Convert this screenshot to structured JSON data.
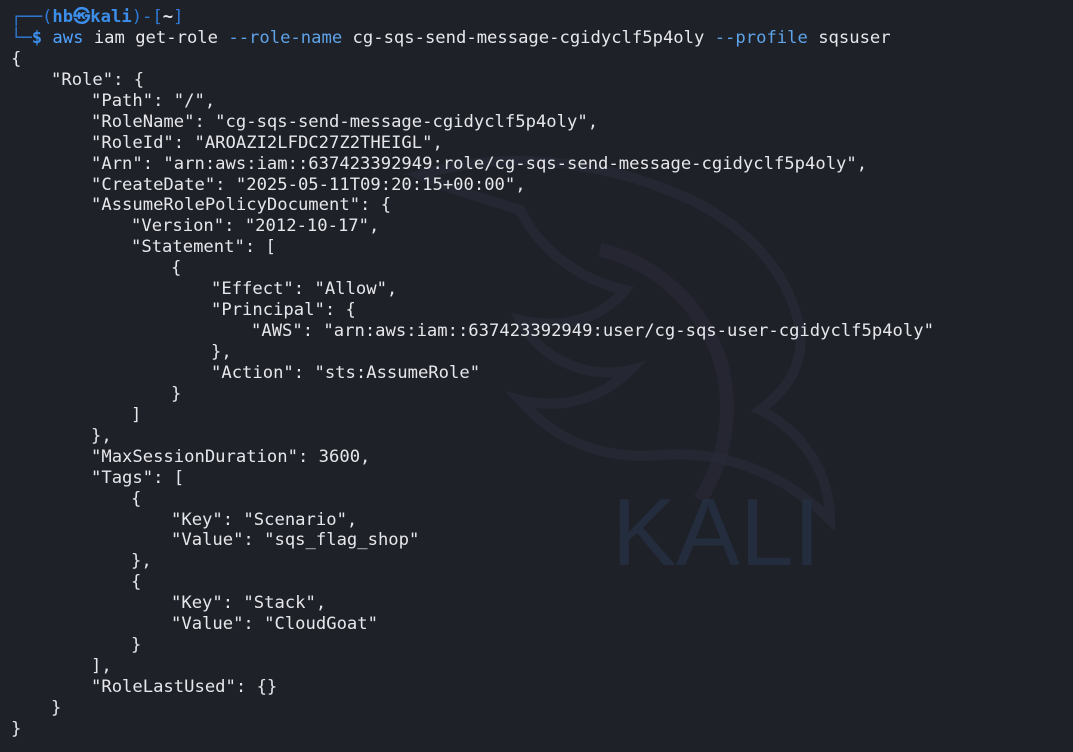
{
  "prompt": {
    "corner_top": "┌──(",
    "user_host": "hb㉿kali",
    "mid": ")-[",
    "cwd": "~",
    "close": "]",
    "corner_bottom": "└─",
    "dollar": "$"
  },
  "command": {
    "exec": "aws",
    "args": " iam get-role ",
    "flag_role": "--role-name",
    "role_value": " cg-sqs-send-message-cgidyclf5p4oly ",
    "flag_profile": "--profile",
    "profile_value": " sqsuser"
  },
  "output_lines": [
    {
      "indent": 0,
      "text": "{"
    },
    {
      "indent": 1,
      "text": "\"Role\": {"
    },
    {
      "indent": 2,
      "text": "\"Path\": \"/\","
    },
    {
      "indent": 2,
      "text": "\"RoleName\": \"cg-sqs-send-message-cgidyclf5p4oly\","
    },
    {
      "indent": 2,
      "text": "\"RoleId\": \"AROAZI2LFDC27Z2THEIGL\","
    },
    {
      "indent": 2,
      "text": "\"Arn\": \"arn:aws:iam::637423392949:role/cg-sqs-send-message-cgidyclf5p4oly\","
    },
    {
      "indent": 2,
      "text": "\"CreateDate\": \"2025-05-11T09:20:15+00:00\","
    },
    {
      "indent": 2,
      "text": "\"AssumeRolePolicyDocument\": {"
    },
    {
      "indent": 3,
      "text": "\"Version\": \"2012-10-17\","
    },
    {
      "indent": 3,
      "text": "\"Statement\": ["
    },
    {
      "indent": 4,
      "text": "{"
    },
    {
      "indent": 5,
      "text": "\"Effect\": \"Allow\","
    },
    {
      "indent": 5,
      "text": "\"Principal\": {"
    },
    {
      "indent": 6,
      "text": "\"AWS\": \"arn:aws:iam::637423392949:user/cg-sqs-user-cgidyclf5p4oly\""
    },
    {
      "indent": 5,
      "text": "},"
    },
    {
      "indent": 5,
      "text": "\"Action\": \"sts:AssumeRole\""
    },
    {
      "indent": 4,
      "text": "}"
    },
    {
      "indent": 3,
      "text": "]"
    },
    {
      "indent": 2,
      "text": "},"
    },
    {
      "indent": 2,
      "text": "\"MaxSessionDuration\": 3600,"
    },
    {
      "indent": 2,
      "text": "\"Tags\": ["
    },
    {
      "indent": 3,
      "text": "{"
    },
    {
      "indent": 4,
      "text": "\"Key\": \"Scenario\","
    },
    {
      "indent": 4,
      "text": "\"Value\": \"sqs_flag_shop\""
    },
    {
      "indent": 3,
      "text": "},"
    },
    {
      "indent": 3,
      "text": "{"
    },
    {
      "indent": 4,
      "text": "\"Key\": \"Stack\","
    },
    {
      "indent": 4,
      "text": "\"Value\": \"CloudGoat\""
    },
    {
      "indent": 3,
      "text": "}"
    },
    {
      "indent": 2,
      "text": "],"
    },
    {
      "indent": 2,
      "text": "\"RoleLastUsed\": {}"
    },
    {
      "indent": 1,
      "text": "}"
    },
    {
      "indent": 0,
      "text": "}"
    }
  ],
  "watermark": {
    "text": "KALI"
  },
  "colors": {
    "background": "#1f2129",
    "text": "#e6e7ea",
    "prompt_accent": "#3b8eea",
    "flag": "#5ea3e8"
  }
}
